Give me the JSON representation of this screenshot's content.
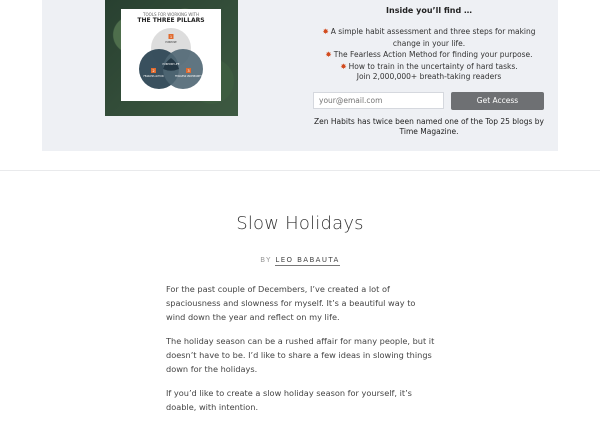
{
  "promo": {
    "book": {
      "subtitle": "TOOLS FOR WORKING WITH",
      "title": "THE THREE PILLARS",
      "circle_labels": [
        "PURPOSE",
        "FEARLESS ACTION",
        "FEARLESS UNCERTAINTY",
        "PURPOSE LIFE"
      ],
      "circle_numbers": [
        "1",
        "2",
        "3"
      ]
    },
    "heading": "Inside you’ll find …",
    "bullets": [
      "A simple habit assessment and three steps for making change in your life.",
      "The Fearless Action Method for finding your purpose.",
      "How to train in the uncertainty of hard tasks."
    ],
    "join_text": "Join 2,000,000+ breath-taking readers",
    "email_placeholder": "your@email.com",
    "button_label": "Get Access",
    "zen_note": "Zen Habits has twice been named one of the Top 25 blogs by Time Magazine.",
    "colors": {
      "bullet_icon": "#d24b1e",
      "button_bg": "#6e7073",
      "panel_bg": "#eef0f4"
    },
    "bullet_icon": "sparkle-icon"
  },
  "post": {
    "title": "Slow Holidays",
    "by_label": "BY",
    "author": "LEO BABAUTA",
    "paragraphs": [
      "For the past couple of Decembers, I’ve created a lot of spaciousness and slowness for myself. It’s a beautiful way to wind down the year and reflect on my life.",
      "The holiday season can be a rushed affair for many people, but it doesn’t have to be. I’d like to share a few ideas in slowing things down for the holidays.",
      "If you’d like to create a slow holiday season for yourself, it’s doable, with intention."
    ]
  }
}
